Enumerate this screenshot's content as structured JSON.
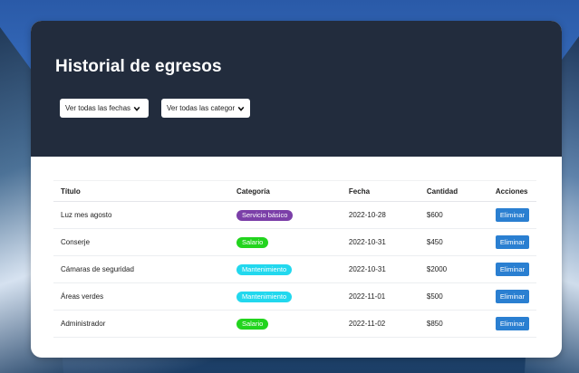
{
  "header": {
    "title": "Historial de egresos"
  },
  "filters": {
    "date_select": {
      "selected": "Ver todas las fechas",
      "icon": "chevron-down-icon"
    },
    "category_select": {
      "selected": "Ver todas las categorías",
      "icon": "chevron-down-icon"
    }
  },
  "table": {
    "headers": [
      "Título",
      "Categoría",
      "Fecha",
      "Cantidad",
      "Acciones"
    ],
    "rows": [
      {
        "title": "Luz mes agosto",
        "category": "Servicio básico",
        "category_color": "#7b3fa8",
        "date": "2022-10-28",
        "amount": "$600",
        "action": "Eliminar"
      },
      {
        "title": "Conserje",
        "category": "Salario",
        "category_color": "#22d41e",
        "date": "2022-10-31",
        "amount": "$450",
        "action": "Eliminar"
      },
      {
        "title": "Cámaras de seguridad",
        "category": "Mantenimiento",
        "category_color": "#22d8ee",
        "date": "2022-10-31",
        "amount": "$2000",
        "action": "Eliminar"
      },
      {
        "title": "Áreas verdes",
        "category": "Mantenimiento",
        "category_color": "#22d8ee",
        "date": "2022-11-01",
        "amount": "$500",
        "action": "Eliminar"
      },
      {
        "title": "Administrador",
        "category": "Salario",
        "category_color": "#22d41e",
        "date": "2022-11-02",
        "amount": "$850",
        "action": "Eliminar"
      }
    ]
  },
  "colors": {
    "header_bg": "#222c3d",
    "delete_button": "#2a7fd1"
  }
}
